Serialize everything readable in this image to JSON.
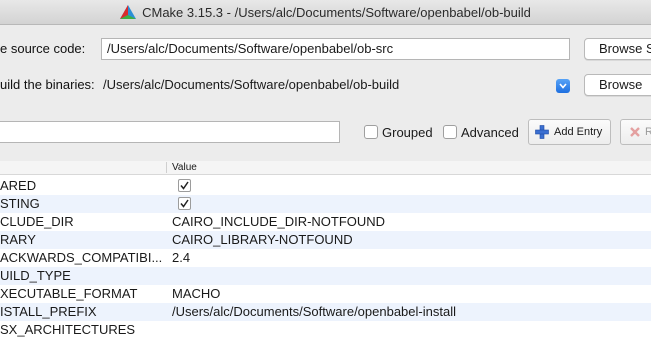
{
  "window": {
    "title": "CMake 3.15.3 - /Users/alc/Documents/Software/openbabel/ob-build"
  },
  "source": {
    "label": "e source code:",
    "value": "/Users/alc/Documents/Software/openbabel/ob-src",
    "browse_label": "Browse S"
  },
  "build": {
    "label": "uild the binaries:",
    "value": "/Users/alc/Documents/Software/openbabel/ob-build",
    "browse_label": "Browse"
  },
  "options": {
    "search_value": "",
    "grouped_label": "Grouped",
    "grouped_checked": false,
    "advanced_label": "Advanced",
    "advanced_checked": false,
    "add_entry_label": "Add Entry",
    "remove_entry_label": "R"
  },
  "table": {
    "value_header": "Value",
    "rows": [
      {
        "name": "ARED",
        "value": "",
        "checkbox": true
      },
      {
        "name": "STING",
        "value": "",
        "checkbox": true
      },
      {
        "name": "CLUDE_DIR",
        "value": "CAIRO_INCLUDE_DIR-NOTFOUND",
        "checkbox": false
      },
      {
        "name": "RARY",
        "value": "CAIRO_LIBRARY-NOTFOUND",
        "checkbox": false
      },
      {
        "name": "ACKWARDS_COMPATIBI...",
        "value": "2.4",
        "checkbox": false
      },
      {
        "name": "UILD_TYPE",
        "value": "",
        "checkbox": false
      },
      {
        "name": "XECUTABLE_FORMAT",
        "value": "MACHO",
        "checkbox": false
      },
      {
        "name": "ISTALL_PREFIX",
        "value": "/Users/alc/Documents/Software/openbabel-install",
        "checkbox": false
      },
      {
        "name": "SX_ARCHITECTURES",
        "value": "",
        "checkbox": false
      }
    ]
  },
  "colors": {
    "accent": "#1e6fe0",
    "row_alt": "#edf3fd"
  }
}
